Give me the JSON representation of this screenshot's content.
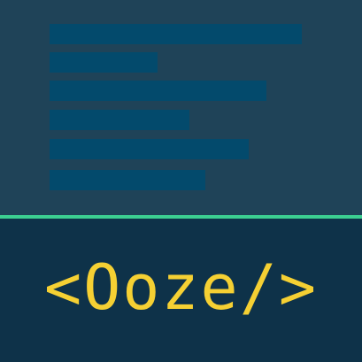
{
  "logo": {
    "text": "<Ooze/>"
  },
  "colors": {
    "top_background": "#1f4358",
    "code_line": "#034a6c",
    "divider": "#3ccf91",
    "bottom_background": "#0e3249",
    "logo_text": "#f5d033"
  }
}
